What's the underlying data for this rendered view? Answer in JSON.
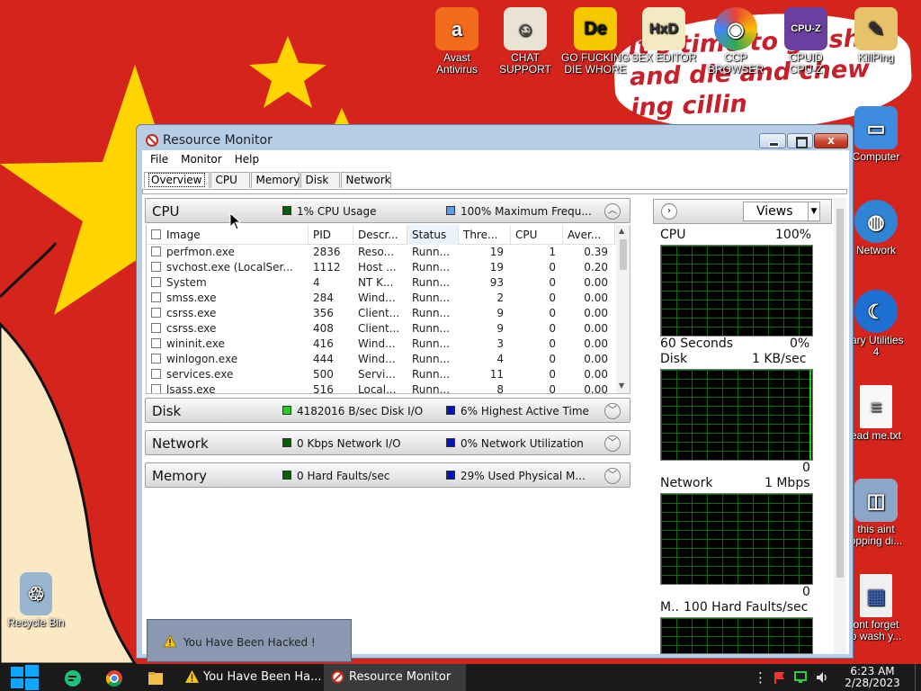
{
  "desktop": {
    "meme_lines": [
      "It's time to go shit",
      "and die and chew",
      "ing cillin"
    ],
    "icons": [
      {
        "id": "avast",
        "label1": "Avast",
        "label2": "Antivirus",
        "color": "#f26b1d",
        "glyph": "a"
      },
      {
        "id": "chat",
        "label1": "CHAT",
        "label2": "SUPPORT",
        "color": "#e9e3d4",
        "glyph": "☺"
      },
      {
        "id": "die",
        "label1": "GO FUCKING",
        "label2": "DIE WHORE",
        "color": "#f5c800",
        "glyph": "De"
      },
      {
        "id": "hxd",
        "label1": "SEX EDITOR",
        "label2": "",
        "color": "#f4e9c0",
        "glyph": "HxD"
      },
      {
        "id": "ccp",
        "label1": "CCP",
        "label2": "BROWSER",
        "color": "#f5b13d",
        "glyph": "◉"
      },
      {
        "id": "cpuz",
        "label1": "CPUID",
        "label2": "CPU-Z",
        "color": "#6b3fa0",
        "glyph": "CPU-Z"
      },
      {
        "id": "kill",
        "label1": "KillPing",
        "label2": "",
        "color": "#e6c26a",
        "glyph": "✎"
      },
      {
        "id": "computer",
        "label1": "Computer",
        "label2": "",
        "color": "#3f8be0",
        "glyph": "▭"
      },
      {
        "id": "network",
        "label1": "Network",
        "label2": "",
        "color": "#2f84d4",
        "glyph": "◍"
      },
      {
        "id": "glary",
        "label1": "lary Utilities",
        "label2": "4",
        "color": "#1d6fd1",
        "glyph": "☾"
      },
      {
        "id": "readme",
        "label1": "ead me.txt",
        "label2": "",
        "color": "#f7f7f7",
        "glyph": "≡"
      },
      {
        "id": "thisaint",
        "label1": "this aint",
        "label2": "opping di...",
        "color": "#8aa6c8",
        "glyph": "◫"
      },
      {
        "id": "dontforget",
        "label1": "ont forget",
        "label2": "o wash y...",
        "color": "#f0f0f0",
        "glyph": "▦"
      },
      {
        "id": "recycle",
        "label1": "Recycle Bin",
        "label2": "",
        "color": "#9ab5cf",
        "glyph": "♲"
      }
    ]
  },
  "window": {
    "title": "Resource Monitor",
    "close_glyph": "x",
    "menu": [
      "File",
      "Monitor",
      "Help"
    ],
    "tabs": [
      "Overview",
      "CPU",
      "Memory",
      "Disk",
      "Network"
    ],
    "cpu_section": {
      "name": "CPU",
      "stat1": "1% CPU Usage",
      "stat1_color": "#0c5c0c",
      "stat2": "100% Maximum Frequ...",
      "stat2_color": "#5b9be8"
    },
    "columns": [
      "Image",
      "PID",
      "Descr...",
      "Status",
      "Thre...",
      "CPU",
      "Aver..."
    ],
    "rows": [
      {
        "image": "perfmon.exe",
        "pid": "2836",
        "desc": "Reso...",
        "status": "Runn...",
        "threads": "19",
        "cpu": "1",
        "avg": "0.39"
      },
      {
        "image": "svchost.exe (LocalSer...",
        "pid": "1112",
        "desc": "Host ...",
        "status": "Runn...",
        "threads": "19",
        "cpu": "0",
        "avg": "0.20"
      },
      {
        "image": "System",
        "pid": "4",
        "desc": "NT K...",
        "status": "Runn...",
        "threads": "93",
        "cpu": "0",
        "avg": "0.00"
      },
      {
        "image": "smss.exe",
        "pid": "284",
        "desc": "Wind...",
        "status": "Runn...",
        "threads": "2",
        "cpu": "0",
        "avg": "0.00"
      },
      {
        "image": "csrss.exe",
        "pid": "356",
        "desc": "Client...",
        "status": "Runn...",
        "threads": "9",
        "cpu": "0",
        "avg": "0.00"
      },
      {
        "image": "csrss.exe",
        "pid": "408",
        "desc": "Client...",
        "status": "Runn...",
        "threads": "9",
        "cpu": "0",
        "avg": "0.00"
      },
      {
        "image": "wininit.exe",
        "pid": "416",
        "desc": "Wind...",
        "status": "Runn...",
        "threads": "3",
        "cpu": "0",
        "avg": "0.00"
      },
      {
        "image": "winlogon.exe",
        "pid": "444",
        "desc": "Wind...",
        "status": "Runn...",
        "threads": "4",
        "cpu": "0",
        "avg": "0.00"
      },
      {
        "image": "services.exe",
        "pid": "500",
        "desc": "Servi...",
        "status": "Runn...",
        "threads": "11",
        "cpu": "0",
        "avg": "0.00"
      },
      {
        "image": "lsass.exe",
        "pid": "516",
        "desc": "Local...",
        "status": "Runn...",
        "threads": "8",
        "cpu": "0",
        "avg": "0.00"
      }
    ],
    "disk_section": {
      "name": "Disk",
      "stat1": "4182016 B/sec Disk I/O",
      "stat1_color": "#19d419",
      "stat2": "6% Highest Active Time",
      "stat2_color": "#0a14b4"
    },
    "network_section": {
      "name": "Network",
      "stat1": "0 Kbps Network I/O",
      "stat1_color": "#0c5c0c",
      "stat2": "0% Network Utilization",
      "stat2_color": "#0a14b4"
    },
    "memory_section": {
      "name": "Memory",
      "stat1": "0 Hard Faults/sec",
      "stat1_color": "#0c5c0c",
      "stat2": "29% Used Physical M...",
      "stat2_color": "#0a14b4"
    },
    "right": {
      "views_label": "Views",
      "graphs": [
        {
          "name": "CPU",
          "top_value": "100%",
          "bottom_left": "60 Seconds",
          "bottom_right": "0%"
        },
        {
          "name": "Disk",
          "top_value": "1 KB/sec",
          "bottom_left": "",
          "bottom_right": "0"
        },
        {
          "name": "Network",
          "top_value": "1 Mbps",
          "bottom_left": "",
          "bottom_right": "0"
        },
        {
          "name": "M..",
          "top_value": "100 Hard Faults/sec",
          "bottom_left": "",
          "bottom_right": ""
        }
      ]
    }
  },
  "notification": {
    "text": "You Have Been Hacked !"
  },
  "taskbar": {
    "tasks": [
      "You Have Been Ha...",
      "Resource Monitor"
    ],
    "time": "6:23 AM",
    "date": "2/28/2023"
  }
}
